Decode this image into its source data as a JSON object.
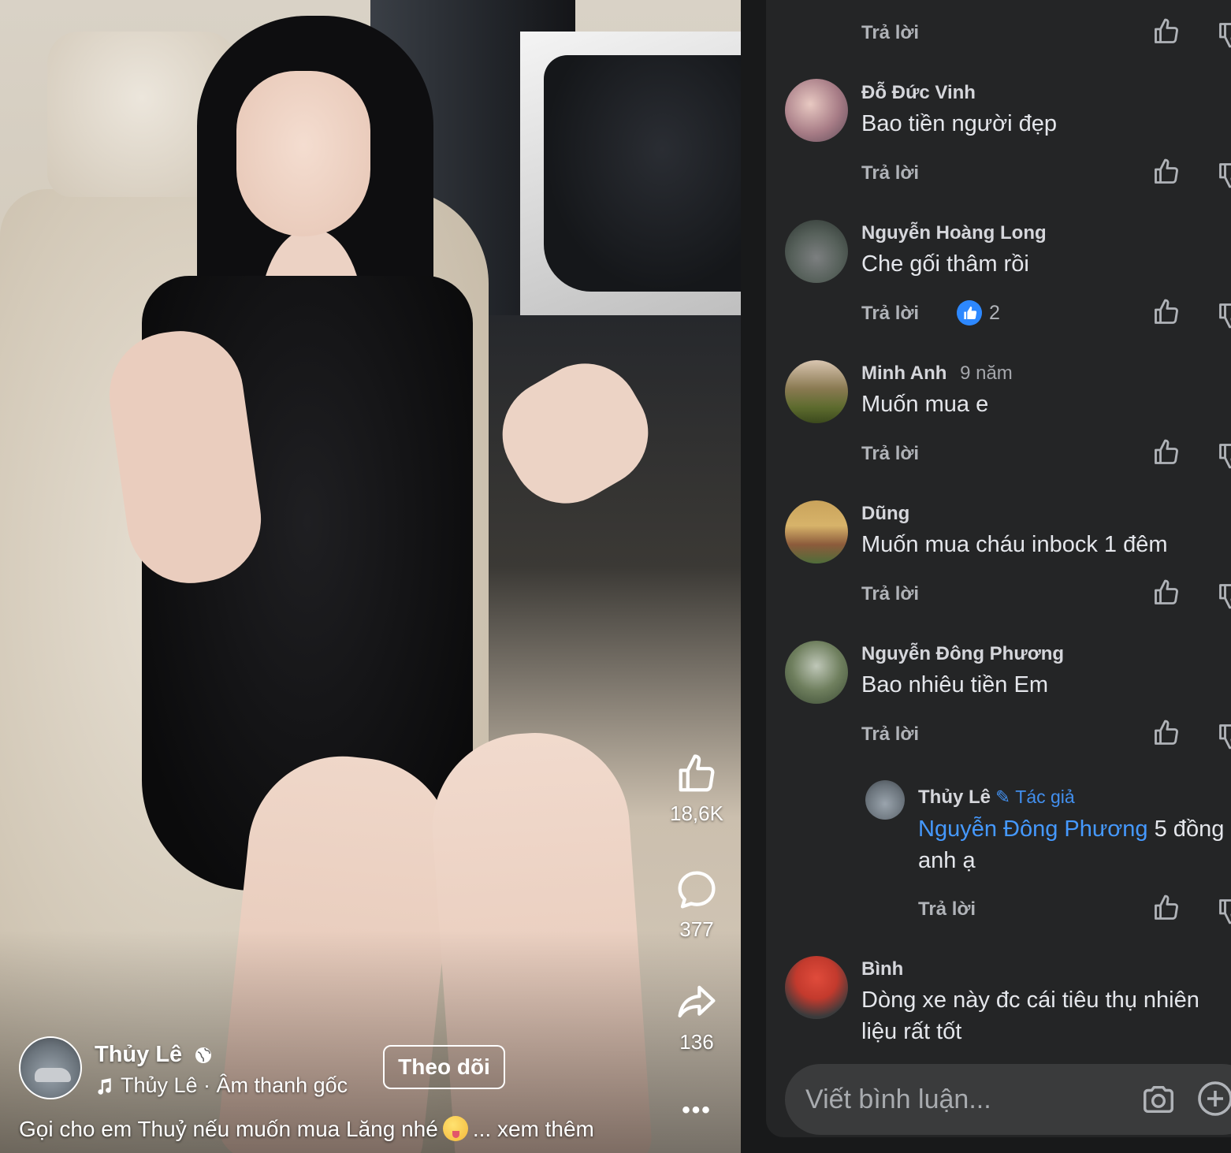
{
  "video": {
    "like_count": "18,6K",
    "comment_count": "377",
    "share_count": "136",
    "more_label": "•••",
    "author_name": "Thủy Lê",
    "audio_label": "Thủy Lê · Âm thanh gốc",
    "follow_label": "Theo dõi",
    "caption_text": "Gọi cho em Thuỷ nếu muốn mua Lăng nhé",
    "caption_more": "... xem thêm"
  },
  "comments": {
    "reply_label": "Trả lời",
    "items": [
      {
        "name": "Đỗ Đức Vinh",
        "text": "Bao tiền người đẹp"
      },
      {
        "name": "Nguyễn Hoàng Long",
        "text": "Che gối thâm rồi",
        "reaction_count": "2"
      },
      {
        "name": "Minh Anh",
        "time": "9 năm",
        "text": "Muốn mua e"
      },
      {
        "name": "Dũng",
        "text": "Muốn mua cháu inbock 1 đêm"
      },
      {
        "name": "Nguyễn Đông Phương",
        "text": "Bao nhiêu tiền Em"
      },
      {
        "name": "Thủy Lê",
        "author_tag": "Tác giả",
        "mention": "Nguyễn Đông Phương",
        "text": "5 đồng anh ạ"
      },
      {
        "name": "Bình",
        "text": "Dòng xe này đc cái tiêu thụ nhiên liệu rất tốt"
      }
    ]
  },
  "composer": {
    "placeholder": "Viết bình luận..."
  },
  "colors": {
    "panel_bg": "#242526",
    "page_bg": "#18191a",
    "accent_blue": "#4599ff",
    "reaction_blue": "#2d88ff",
    "muted_text": "#b0b3b8"
  }
}
